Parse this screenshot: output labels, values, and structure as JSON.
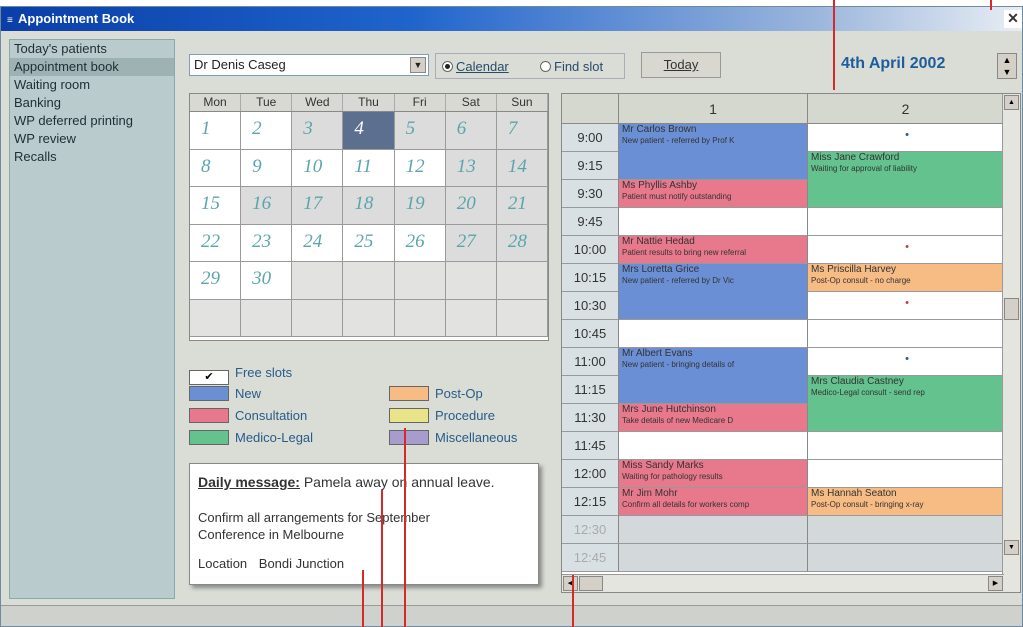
{
  "window": {
    "title": "Appointment Book",
    "close_glyph": "✕",
    "title_icon": "≡"
  },
  "sidebar": {
    "items": [
      {
        "label": "Today's patients"
      },
      {
        "label": "Appointment book"
      },
      {
        "label": "Waiting room"
      },
      {
        "label": "Banking"
      },
      {
        "label": "WP deferred printing"
      },
      {
        "label": "WP review"
      },
      {
        "label": "Recalls"
      }
    ]
  },
  "toolbar": {
    "doctor": "Dr Denis Caseg",
    "dropdown_glyph": "▼",
    "mode_calendar": "Calendar",
    "mode_find": "Find slot",
    "selected_mode": "calendar",
    "today_label": "Today",
    "date": "4th April 2002",
    "spin_up": "▲",
    "spin_down": "▼"
  },
  "calendar": {
    "days": [
      "Mon",
      "Tue",
      "Wed",
      "Thu",
      "Fri",
      "Sat",
      "Sun"
    ],
    "weeks": [
      [
        "1",
        "2",
        "3",
        "4",
        "5",
        "6",
        "7"
      ],
      [
        "8",
        "9",
        "10",
        "11",
        "12",
        "13",
        "14"
      ],
      [
        "15",
        "16",
        "17",
        "18",
        "19",
        "20",
        "21"
      ],
      [
        "22",
        "23",
        "24",
        "25",
        "26",
        "27",
        "28"
      ],
      [
        "29",
        "30",
        "",
        "",
        "",
        "",
        ""
      ],
      [
        "",
        "",
        "",
        "",
        "",
        "",
        ""
      ]
    ],
    "selected": "4"
  },
  "legend": {
    "free_slots": "Free slots",
    "check": "✔",
    "items": [
      {
        "label": "New",
        "color": "#6b8fd4"
      },
      {
        "label": "Consultation",
        "color": "#e8788c"
      },
      {
        "label": "Medico-Legal",
        "color": "#63c28e"
      },
      {
        "label": "Post-Op",
        "color": "#f7bb84"
      },
      {
        "label": "Procedure",
        "color": "#e9e38a"
      },
      {
        "label": "Miscellaneous",
        "color": "#a79ccc"
      }
    ]
  },
  "message": {
    "heading": "Daily message:",
    "body": "Pamela away on annual leave.",
    "line2": "Confirm all arrangements for September",
    "line3": "Conference in Melbourne",
    "location_label": "Location",
    "location_value": "Bondi Junction"
  },
  "schedule": {
    "columns": [
      "1",
      "2"
    ],
    "times": [
      "9:00",
      "9:15",
      "9:30",
      "9:45",
      "10:00",
      "10:15",
      "10:30",
      "10:45",
      "11:00",
      "11:15",
      "11:30",
      "11:45",
      "12:00",
      "12:15",
      "12:30",
      "12:45"
    ],
    "appointments": [
      {
        "name": "Mr Carlos Brown",
        "note": "New patient - referred by Prof K",
        "type": "New"
      },
      {
        "name": "Miss Jane Crawford",
        "note": "Waiting for approval of liability",
        "type": "Medico-Legal"
      },
      {
        "name": "Ms Phyllis Ashby",
        "note": "Patient must notify outstanding",
        "type": "Consultation"
      },
      {
        "name": "Mr Nattie Hedad",
        "note": "Patient results to bring new referral",
        "type": "Consultation"
      },
      {
        "name": "Mrs Loretta Grice",
        "note": "New patient - referred by Dr Vic",
        "type": "New"
      },
      {
        "name": "Ms Priscilla Harvey",
        "note": "Post-Op consult - no charge",
        "type": "Post-Op"
      },
      {
        "name": "Mr Albert Evans",
        "note": "New patient - bringing details of",
        "type": "New"
      },
      {
        "name": "Mrs Claudia Castney",
        "note": "Medico-Legal consult - send rep",
        "type": "Medico-Legal"
      },
      {
        "name": "Mrs June Hutchinson",
        "note": "Take details of new Medicare D",
        "type": "Consultation"
      },
      {
        "name": "Miss Sandy Marks",
        "note": "Waiting for pathology results",
        "type": "Consultation"
      },
      {
        "name": "Mr Jim Mohr",
        "note": "Confirm all details for workers comp",
        "type": "Consultation"
      },
      {
        "name": "Ms Hannah Seaton",
        "note": "Post-Op consult - bringing x-ray",
        "type": "Post-Op"
      }
    ],
    "markers": {
      "free": "•"
    },
    "scroll": {
      "up": "▲",
      "down": "▼",
      "left": "◀",
      "right": "▶"
    }
  }
}
